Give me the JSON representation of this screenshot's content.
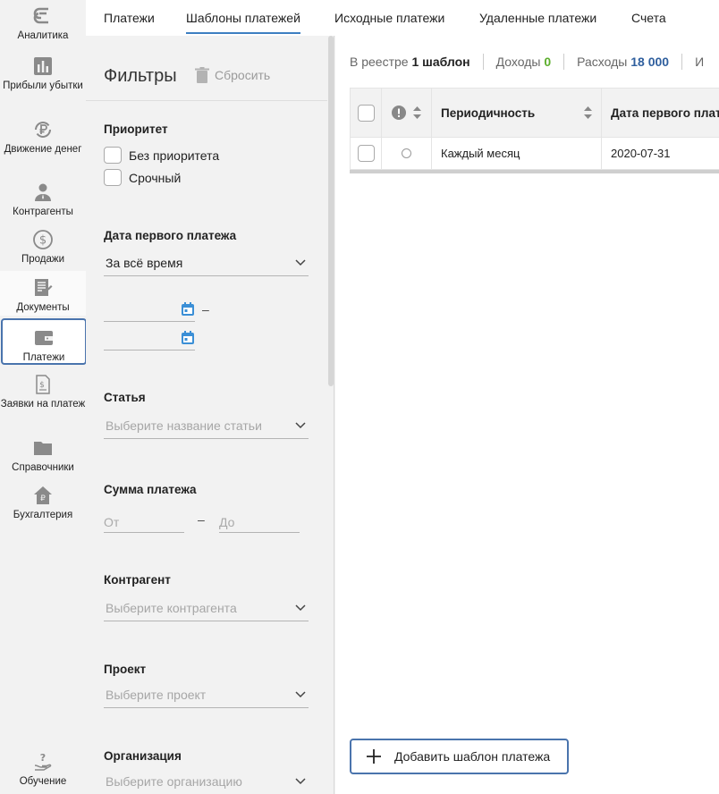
{
  "colors": {
    "accent": "#3d7fc1",
    "active_border": "#4a74ad",
    "income": "#5cae2c",
    "expenses": "#2f5f9e",
    "calendar_icon": "#3b8fd6"
  },
  "rail": {
    "items": [
      {
        "label": "Аналитика",
        "icon": "analytics-icon"
      },
      {
        "label": "Прибыли убытки",
        "icon": "bar-chart-icon"
      },
      {
        "label": "Движение денег",
        "icon": "ruble-cycle-icon"
      },
      {
        "label": "Контрагенты",
        "icon": "person-icon"
      },
      {
        "label": "Продажи",
        "icon": "dollar-circle-icon"
      },
      {
        "label": "Документы",
        "icon": "documents-icon"
      },
      {
        "label": "Платежи",
        "icon": "wallet-icon"
      },
      {
        "label": "Заявки на платеж",
        "icon": "payment-request-icon"
      },
      {
        "label": "Справочники",
        "icon": "folder-icon"
      },
      {
        "label": "Бухгалтерия",
        "icon": "accounting-icon"
      }
    ],
    "help_label": "Обучение"
  },
  "tabs": [
    "Платежи",
    "Шаблоны платежей",
    "Исходные платежи",
    "Удаленные платежи",
    "Счета"
  ],
  "filters": {
    "title": "Фильтры",
    "reset": "Сбросить",
    "priority": {
      "label": "Приоритет",
      "options": [
        "Без приоритета",
        "Срочный"
      ]
    },
    "first_date": {
      "label": "Дата первого платежа",
      "value": "За всё время",
      "dash": "–"
    },
    "article": {
      "label": "Статья",
      "placeholder": "Выберите название статьи"
    },
    "amount": {
      "label": "Сумма платежа",
      "from": "От",
      "dash": "–",
      "to": "До"
    },
    "counterparty": {
      "label": "Контрагент",
      "placeholder": "Выберите контрагента"
    },
    "project": {
      "label": "Проект",
      "placeholder": "Выберите проект"
    },
    "organization": {
      "label": "Организация",
      "placeholder": "Выберите организацию"
    }
  },
  "summary": {
    "registry_prefix": "В реестре",
    "registry_count": "1 шаблон",
    "income_label": "Доходы",
    "income_value": "0",
    "expenses_label": "Расходы",
    "expenses_value": "18 000",
    "cut_label": "И"
  },
  "table": {
    "columns": [
      "Периодичность",
      "Дата первого плат"
    ],
    "rows": [
      {
        "period": "Каждый месяц",
        "first_date": "2020-07-31"
      }
    ]
  },
  "add_button": "Добавить шаблон платежа"
}
